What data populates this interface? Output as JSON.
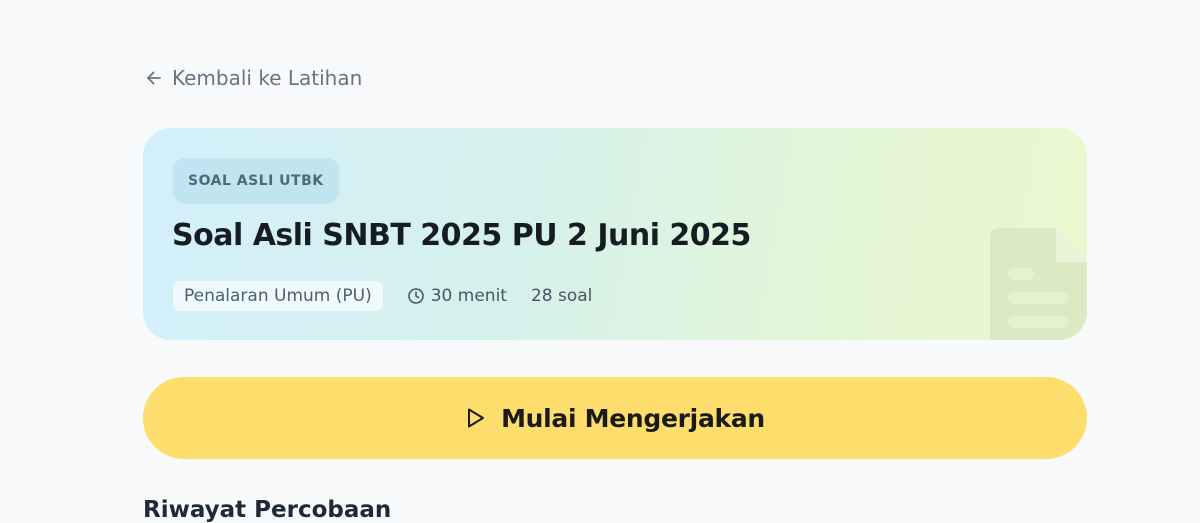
{
  "back_link": {
    "label": "Kembali ke Latihan",
    "icon": "arrow-left-icon"
  },
  "exam": {
    "category_badge": "SOAL ASLI UTBK",
    "title": "Soal Asli SNBT 2025 PU 2 Juni 2025",
    "subject": "Penalaran Umum (PU)",
    "duration": "30 menit",
    "duration_icon": "clock-icon",
    "question_count": "28 soal",
    "watermark_icon": "document-icon"
  },
  "start_button": {
    "label": "Mulai Mengerjakan",
    "icon": "play-icon"
  },
  "attempt_history": {
    "heading": "Riwayat Percobaan"
  },
  "colors": {
    "page_background": "#f8f9fb",
    "hero_gradient_start": "#d3effb",
    "hero_gradient_end": "#eaf8ce",
    "start_button": "#fddd6c",
    "badge_text": "#4b6b7b",
    "title_text": "#171c22"
  }
}
